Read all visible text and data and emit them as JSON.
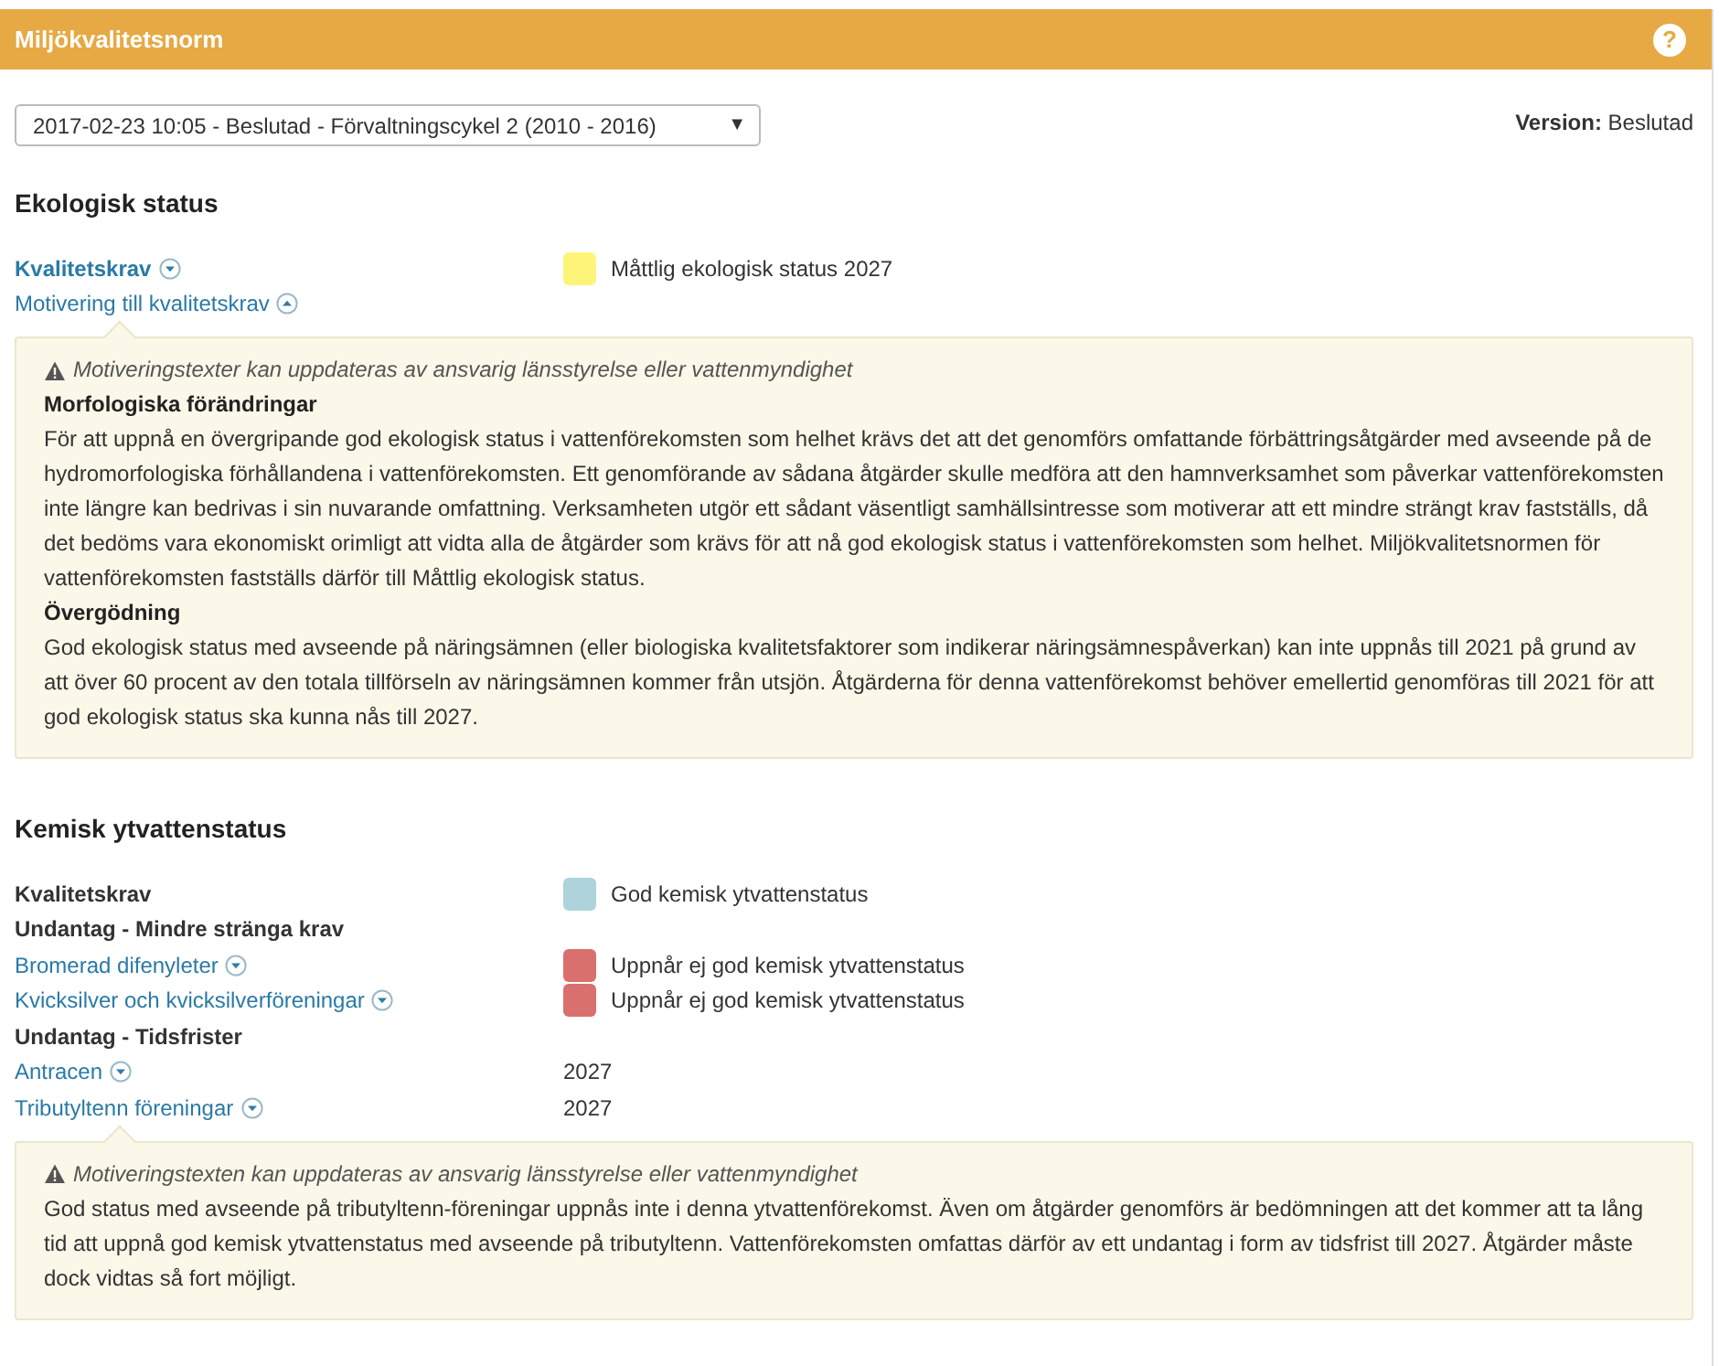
{
  "header": {
    "title": "Miljökvalitetsnorm",
    "help": "?"
  },
  "version_select": {
    "value": "2017-02-23 10:05 - Beslutad - Förvaltningscykel 2 (2010 - 2016)",
    "arrow": "▼"
  },
  "version": {
    "label": "Version:",
    "value": "Beslutad"
  },
  "sections": [
    {
      "heading": "Ekologisk status",
      "rows": [
        {
          "kind": "main-link",
          "label": "Kvalitetskrav",
          "expanded": false,
          "status": {
            "text": "Måttlig ekologisk status 2027",
            "color": "#fff47a"
          }
        },
        {
          "kind": "link",
          "label": "Motivering till kvalitetskrav",
          "expanded": true
        }
      ],
      "note": {
        "warning": "Motiveringstexter kan uppdateras av ansvarig länsstyrelse eller vattenmyndighet",
        "paragraphs": [
          {
            "kind": "heading",
            "text": "Morfologiska förändringar"
          },
          {
            "kind": "text",
            "text": "För att uppnå en övergripande god ekologisk status i vattenförekomsten som helhet krävs det att det genomförs omfattande förbättringsåtgärder med avseende på de hydromorfologiska förhållandena i vattenförekomsten. Ett genomförande av sådana åtgärder skulle medföra att den hamnverksamhet som påverkar vattenförekomsten inte längre kan bedrivas i sin nuvarande omfattning. Verksamheten utgör ett sådant väsentligt samhällsintresse som motiverar att ett mindre strängt krav fastställs, då det bedöms vara ekonomiskt orimligt att vidta alla de åtgärder som krävs för att nå god ekologisk status i vattenförekomsten som helhet. Miljökvalitetsnormen för vattenförekomsten fastställs därför till Måttlig ekologisk status."
          },
          {
            "kind": "heading",
            "text": "Övergödning"
          },
          {
            "kind": "text",
            "text": "God ekologisk status med avseende på näringsämnen (eller biologiska kvalitetsfaktorer som indikerar näringsämnespåverkan) kan inte uppnås till 2021 på grund av att över 60 procent av den totala tillförseln av näringsämnen kommer från utsjön. Åtgärderna för denna vattenförekomst behöver emellertid genomföras till 2021 för att god ekologisk status ska kunna nås till 2027."
          }
        ]
      }
    },
    {
      "heading": "Kemisk ytvattenstatus",
      "rows": [
        {
          "kind": "label",
          "label": "Kvalitetskrav",
          "status": {
            "text": "God kemisk ytvattenstatus",
            "color": "#add3db"
          }
        },
        {
          "kind": "label",
          "label": "Undantag - Mindre stränga krav"
        },
        {
          "kind": "link",
          "label": "Bromerad difenyleter",
          "expanded": false,
          "status": {
            "text": "Uppnår ej god kemisk ytvattenstatus",
            "color": "#d9706d"
          }
        },
        {
          "kind": "link",
          "label": "Kvicksilver och kvicksilverföreningar",
          "expanded": false,
          "status": {
            "text": "Uppnår ej god kemisk ytvattenstatus",
            "color": "#d9706d"
          }
        },
        {
          "kind": "label",
          "label": "Undantag - Tidsfrister"
        },
        {
          "kind": "link",
          "label": "Antracen",
          "expanded": false,
          "value": "2027"
        },
        {
          "kind": "link",
          "label": "Tributyltenn föreningar",
          "expanded": false,
          "value": "2027"
        }
      ],
      "note": {
        "warning": "Motiveringstexten kan uppdateras av ansvarig länsstyrelse eller vattenmyndighet",
        "paragraphs": [
          {
            "kind": "text",
            "text": "God status med avseende på tributyltenn-föreningar uppnås inte i denna ytvattenförekomst. Även om åtgärder genomförs är bedömningen att det kommer att ta lång tid att uppnå god kemisk ytvattenstatus med avseende på tributyltenn. Vattenförekomsten omfattas därför av ett undantag i form av tidsfrist till 2027. Åtgärder måste dock vidtas så fort möjligt."
          }
        ]
      }
    }
  ]
}
